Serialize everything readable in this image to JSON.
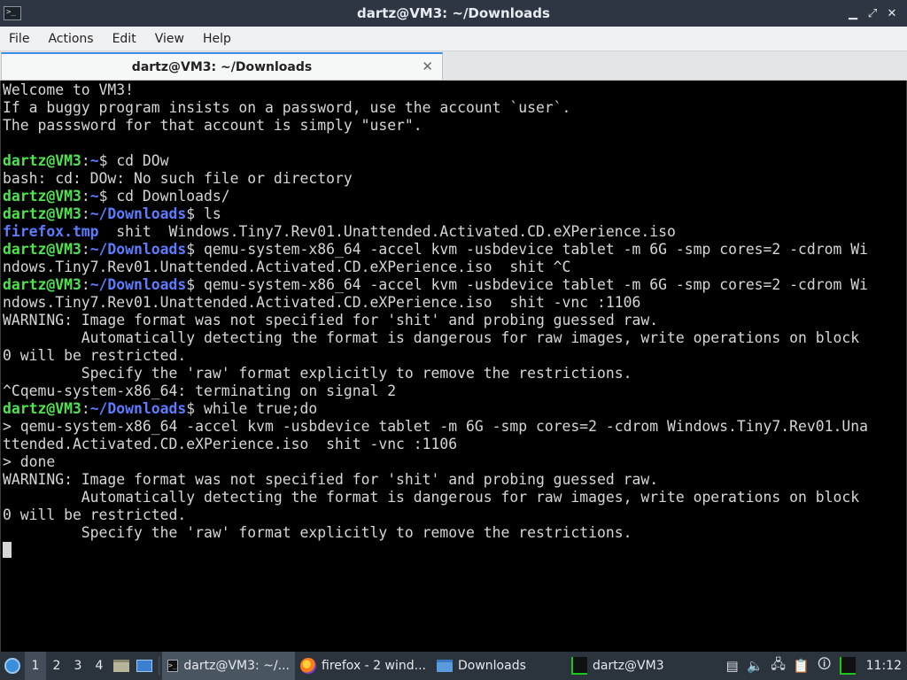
{
  "window": {
    "title": "dartz@VM3: ~/Downloads",
    "controls": {
      "minimize": "▁",
      "restore": "⤢",
      "close": "✕"
    }
  },
  "menu": [
    "File",
    "Actions",
    "Edit",
    "View",
    "Help"
  ],
  "tab": {
    "label": "dartz@VM3: ~/Downloads",
    "close": "✕"
  },
  "terminal": {
    "lines": [
      {
        "text": "Welcome to VM3!"
      },
      {
        "text": "If a buggy program insists on a password, use the account `user`."
      },
      {
        "text": "The passsword for that account is simply \"user\"."
      },
      {
        "text": ""
      },
      {
        "prompt": {
          "user": "dartz@VM3",
          "path": "~"
        },
        "text": "cd DOw"
      },
      {
        "text": "bash: cd: DOw: No such file or directory"
      },
      {
        "prompt": {
          "user": "dartz@VM3",
          "path": "~"
        },
        "text": "cd Downloads/"
      },
      {
        "prompt": {
          "user": "dartz@VM3",
          "path": "~/Downloads"
        },
        "text": "ls"
      },
      {
        "blue": "firefox.tmp",
        "text": "  shit  Windows.Tiny7.Rev01.Unattended.Activated.CD.eXPerience.iso"
      },
      {
        "prompt": {
          "user": "dartz@VM3",
          "path": "~/Downloads"
        },
        "text": "qemu-system-x86_64 -accel kvm -usbdevice tablet -m 6G -smp cores=2 -cdrom Wi"
      },
      {
        "text": "ndows.Tiny7.Rev01.Unattended.Activated.CD.eXPerience.iso  shit ^C"
      },
      {
        "prompt": {
          "user": "dartz@VM3",
          "path": "~/Downloads"
        },
        "text": "qemu-system-x86_64 -accel kvm -usbdevice tablet -m 6G -smp cores=2 -cdrom Wi"
      },
      {
        "text": "ndows.Tiny7.Rev01.Unattended.Activated.CD.eXPerience.iso  shit -vnc :1106"
      },
      {
        "text": "WARNING: Image format was not specified for 'shit' and probing guessed raw."
      },
      {
        "text": "         Automatically detecting the format is dangerous for raw images, write operations on block"
      },
      {
        "text": "0 will be restricted."
      },
      {
        "text": "         Specify the 'raw' format explicitly to remove the restrictions."
      },
      {
        "text": "^Cqemu-system-x86_64: terminating on signal 2"
      },
      {
        "prompt": {
          "user": "dartz@VM3",
          "path": "~/Downloads"
        },
        "text": "while true;do"
      },
      {
        "text": "> qemu-system-x86_64 -accel kvm -usbdevice tablet -m 6G -smp cores=2 -cdrom Windows.Tiny7.Rev01.Una"
      },
      {
        "text": "ttended.Activated.CD.eXPerience.iso  shit -vnc :1106"
      },
      {
        "text": "> done"
      },
      {
        "text": "WARNING: Image format was not specified for 'shit' and probing guessed raw."
      },
      {
        "text": "         Automatically detecting the format is dangerous for raw images, write operations on block"
      },
      {
        "text": "0 will be restricted."
      },
      {
        "text": "         Specify the 'raw' format explicitly to remove the restrictions."
      },
      {
        "cursor": true
      }
    ]
  },
  "taskbar": {
    "workspaces": [
      "1",
      "2",
      "3",
      "4"
    ],
    "active_workspace": "1",
    "tasks": [
      {
        "label": "dartz@VM3: ~/...",
        "icon": "terminal-icon",
        "active": true
      },
      {
        "label": "firefox - 2 wind...",
        "icon": "firefox-icon",
        "active": false
      },
      {
        "label": "Downloads",
        "icon": "folder-icon",
        "active": false
      },
      {
        "label": "dartz@VM3",
        "icon": "system-monitor-icon",
        "active": false
      }
    ],
    "clock": "11:12",
    "tray_icons": [
      "keyboard-layout-icon",
      "volume-icon",
      "network-icon",
      "clipboard-icon",
      "updates-icon",
      "system-monitor-icon"
    ]
  },
  "colors": {
    "prompt_user": "#4ee44e",
    "prompt_path": "#5c7cff",
    "terminal_bg": "#000000",
    "terminal_fg": "#d6d6d6",
    "titlebar_bg": "#2d3642",
    "taskbar_bg": "#2b333c"
  }
}
